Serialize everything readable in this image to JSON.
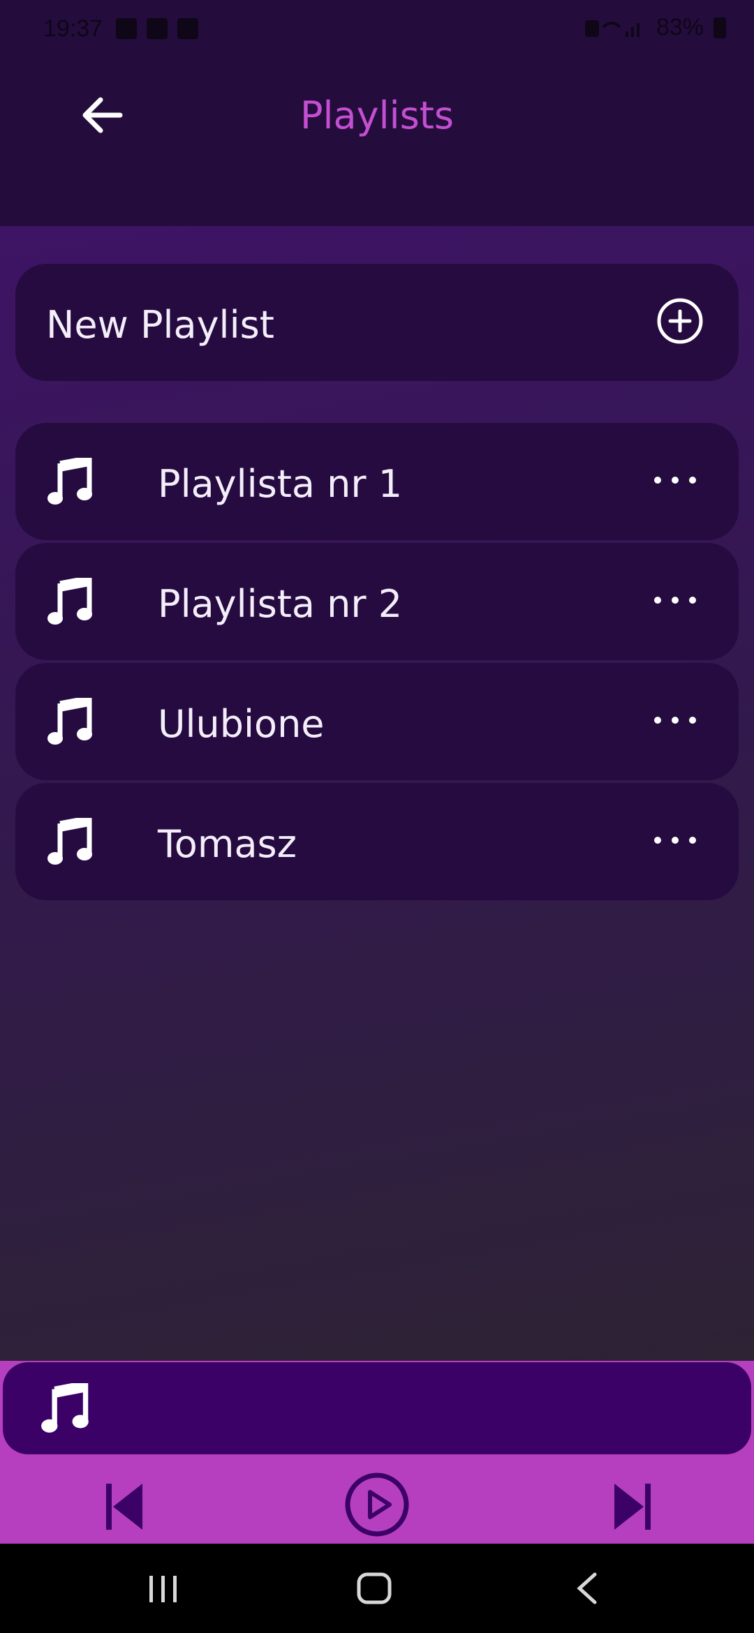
{
  "status_bar": {
    "time": "19:37",
    "battery": "83%",
    "icons": [
      "gallery-icon",
      "grid-app-icon",
      "media-icon",
      "vibrate-icon",
      "wifi-icon",
      "volte-icon",
      "signal-icon",
      "battery-icon"
    ]
  },
  "header": {
    "title": "Playlists",
    "back_icon": "arrow-left-icon"
  },
  "new_playlist": {
    "label": "New Playlist",
    "icon": "plus-circle-icon"
  },
  "playlists": [
    {
      "name": "Playlista nr 1",
      "icon": "music-note-icon",
      "menu_icon": "more-horizontal-icon"
    },
    {
      "name": "Playlista nr 2",
      "icon": "music-note-icon",
      "menu_icon": "more-horizontal-icon"
    },
    {
      "name": "Ulubione",
      "icon": "music-note-icon",
      "menu_icon": "more-horizontal-icon"
    },
    {
      "name": "Tomasz",
      "icon": "music-note-icon",
      "menu_icon": "more-horizontal-icon"
    }
  ],
  "player": {
    "now_playing_icon": "music-note-icon",
    "controls": [
      "skip-previous-icon",
      "play-circle-icon",
      "skip-next-icon"
    ]
  },
  "system_nav": [
    "recents-icon",
    "home-icon",
    "back-icon"
  ],
  "colors": {
    "accent": "#c44fd2",
    "player_bar": "#b63fbf",
    "card": "#260b40",
    "now_playing": "#3b0167",
    "header_bg": "#240d3c"
  }
}
